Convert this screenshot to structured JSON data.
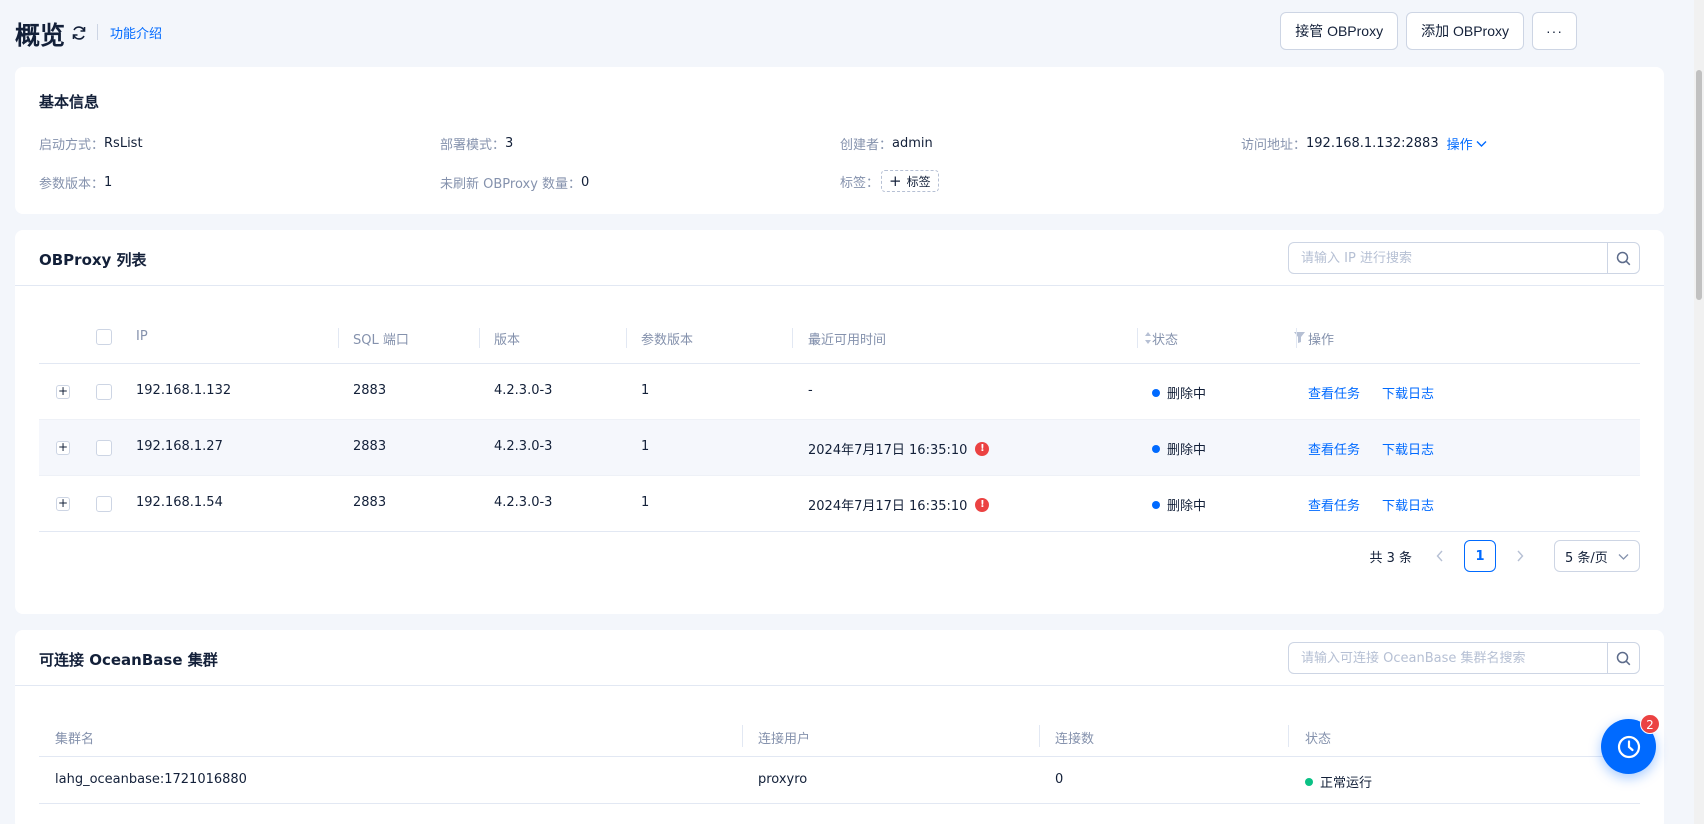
{
  "header": {
    "title": "概览",
    "intro_link": "功能介绍",
    "actions": {
      "takeover": "接管 OBProxy",
      "add": "添加 OBProxy",
      "more": "···"
    }
  },
  "basic_info": {
    "title": "基本信息",
    "start_mode": {
      "label": "启动方式：",
      "value": "RsList"
    },
    "deploy_mode": {
      "label": "部署模式：",
      "value": "3"
    },
    "creator": {
      "label": "创建者：",
      "value": "admin"
    },
    "address": {
      "label": "访问地址：",
      "value": "192.168.1.132:2883",
      "action": "操作"
    },
    "param_version": {
      "label": "参数版本：",
      "value": "1"
    },
    "unrefreshed": {
      "label": "未刷新 OBProxy 数量：",
      "value": "0"
    },
    "tags": {
      "label": "标签：",
      "add": "标签"
    }
  },
  "proxy_list": {
    "title": "OBProxy 列表",
    "search_placeholder": "请输入 IP 进行搜索",
    "columns": {
      "ip": "IP",
      "sql_port": "SQL 端口",
      "version": "版本",
      "param_version": "参数版本",
      "last_available": "最近可用时间",
      "status": "状态",
      "ops": "操作"
    },
    "rows": [
      {
        "ip": "192.168.1.132",
        "port": "2883",
        "version": "4.2.3.0-3",
        "param_version": "1",
        "last_available": "-",
        "warn": false,
        "status": "删除中",
        "op_view": "查看任务",
        "op_download": "下载日志"
      },
      {
        "ip": "192.168.1.27",
        "port": "2883",
        "version": "4.2.3.0-3",
        "param_version": "1",
        "last_available": "2024年7月17日 16:35:10",
        "warn": true,
        "status": "删除中",
        "op_view": "查看任务",
        "op_download": "下载日志"
      },
      {
        "ip": "192.168.1.54",
        "port": "2883",
        "version": "4.2.3.0-3",
        "param_version": "1",
        "last_available": "2024年7月17日 16:35:10",
        "warn": true,
        "status": "删除中",
        "op_view": "查看任务",
        "op_download": "下载日志"
      }
    ],
    "pagination": {
      "total": "共 3 条",
      "page": "1",
      "page_size": "5 条/页"
    }
  },
  "clusters": {
    "title": "可连接 OceanBase 集群",
    "search_placeholder": "请输入可连接 OceanBase 集群名搜索",
    "columns": {
      "name": "集群名",
      "user": "连接用户",
      "count": "连接数",
      "status": "状态"
    },
    "rows": [
      {
        "name": "lahg_oceanbase:1721016880",
        "user": "proxyro",
        "count": "0",
        "status": "正常运行"
      }
    ]
  },
  "float_help": {
    "badge": "2"
  },
  "colors": {
    "accent": "#006aff",
    "deleting": "#006aff",
    "running": "#0ac185",
    "warning": "#eb4242"
  }
}
